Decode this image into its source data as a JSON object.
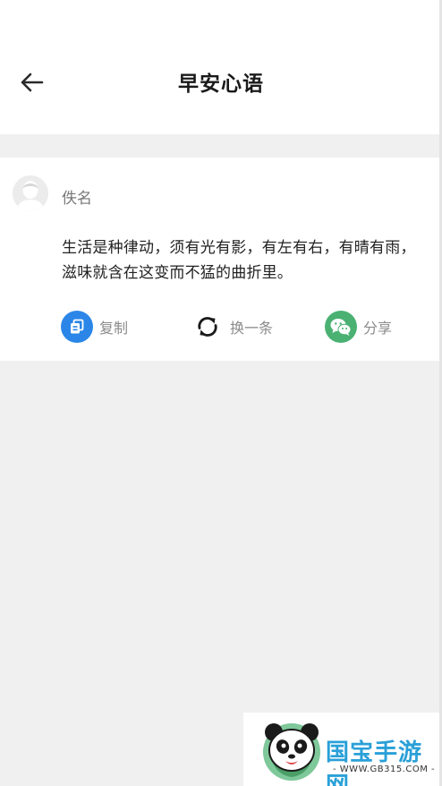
{
  "header": {
    "title": "早安心语",
    "back_icon": "arrow-left-icon"
  },
  "quote_card": {
    "author": "佚名",
    "text": "生活是种律动，须有光有影，有左有右，有晴有雨，滋味就含在这变而不猛的曲折里。",
    "actions": [
      {
        "label": "复制",
        "icon": "copy-icon",
        "color": "#2b86e8"
      },
      {
        "label": "换一条",
        "icon": "refresh-icon",
        "color": "#222222"
      },
      {
        "label": "分享",
        "icon": "wechat-icon",
        "color": "#4ab173"
      }
    ]
  },
  "watermark": {
    "brand": "国宝手游网",
    "url": "- WWW.GB315.COM -"
  }
}
